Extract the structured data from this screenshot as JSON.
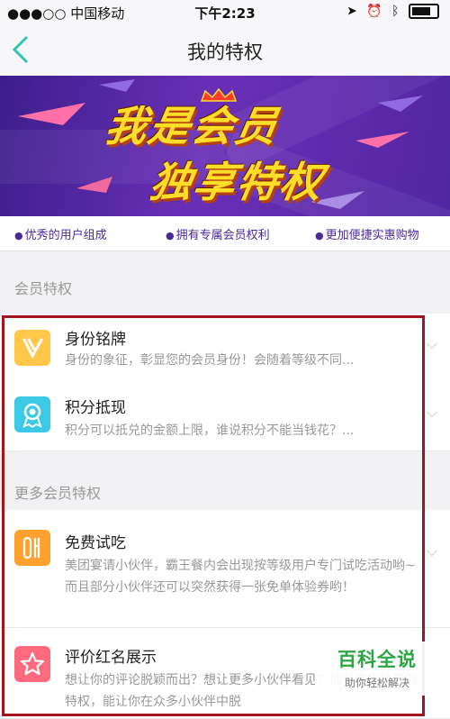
{
  "status_bar": {
    "carrier": "●●●○○ 中国移动",
    "time": "下午2:23"
  },
  "nav": {
    "back_label": "<",
    "title": "我的特权"
  },
  "banner": {
    "line1": "我是会员",
    "line2": "独享特权"
  },
  "features": [
    "优秀的用户组成",
    "拥有专属会员权利",
    "更加便捷实惠购物"
  ],
  "sections": {
    "member": "会员特权",
    "more": "更多会员特权"
  },
  "items": [
    {
      "title": "身份铭牌",
      "desc": "身份的象征，彰显您的会员身份！会随着等级不同...",
      "icon": "v-badge-icon",
      "color": "#ffc84a"
    },
    {
      "title": "积分抵现",
      "desc": "积分可以抵兑的金额上限，谁说积分不能当钱花？...",
      "icon": "medal-icon",
      "color": "#3cc9e6"
    },
    {
      "title": "免费试吃",
      "desc": "美团宴请小伙伴，霸王餐内会出现按等级用户专门试吃活动哟~而且部分小伙伴还可以突然获得一张免单体验券哟！",
      "icon": "cutlery-icon",
      "color": "#ffa12e"
    },
    {
      "title": "评价红名展示",
      "desc": "想让你的评论脱颖而出？想让更多小伙伴看见？拥有这样拉轰的特权，能让你在众多小伙伴中脱",
      "icon": "star-icon",
      "color": "#ff6a7c"
    }
  ],
  "watermark": {
    "title": "百科全说",
    "subtitle": "助你轻松解决"
  }
}
